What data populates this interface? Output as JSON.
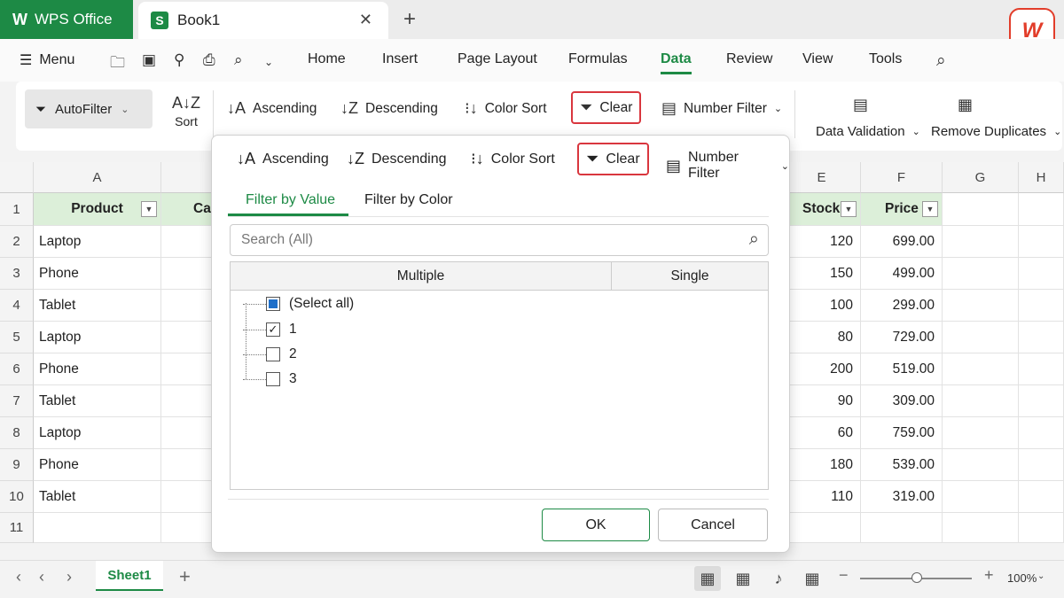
{
  "titlebar": {
    "app_tab": "WPS Office",
    "app_logo": "W",
    "doc_tab": "Book1",
    "doc_icon": "S",
    "brand_logo": "W"
  },
  "menubar": {
    "menu_label": "Menu",
    "tabs": [
      "Home",
      "Insert",
      "Page Layout",
      "Formulas",
      "Data",
      "Review",
      "View",
      "Tools"
    ],
    "active_tab": "Data"
  },
  "ribbon": {
    "autofilter": "AutoFilter",
    "sort": "Sort",
    "ascending": "Ascending",
    "descending": "Descending",
    "color_sort": "Color Sort",
    "clear": "Clear",
    "number_filter": "Number Filter",
    "data_validation": "Data Validation",
    "remove_duplicates": "Remove Duplicates"
  },
  "grid": {
    "columns": [
      "A",
      "E",
      "F",
      "G",
      "H"
    ],
    "header_row": {
      "product": "Product",
      "category_partial": "Ca",
      "stock": "Stock",
      "price": "Price"
    },
    "rows": [
      {
        "num": "1"
      },
      {
        "num": "2",
        "product": "Laptop",
        "stock": "120",
        "price": "699.00"
      },
      {
        "num": "3",
        "product": "Phone",
        "stock": "150",
        "price": "499.00"
      },
      {
        "num": "4",
        "product": "Tablet",
        "stock": "100",
        "price": "299.00"
      },
      {
        "num": "5",
        "product": "Laptop",
        "stock": "80",
        "price": "729.00"
      },
      {
        "num": "6",
        "product": "Phone",
        "stock": "200",
        "price": "519.00"
      },
      {
        "num": "7",
        "product": "Tablet",
        "stock": "90",
        "price": "309.00"
      },
      {
        "num": "8",
        "product": "Laptop",
        "stock": "60",
        "price": "759.00"
      },
      {
        "num": "9",
        "product": "Phone",
        "stock": "180",
        "price": "539.00"
      },
      {
        "num": "10",
        "product": "Tablet",
        "stock": "110",
        "price": "319.00"
      },
      {
        "num": "11"
      }
    ]
  },
  "popup": {
    "ascending": "Ascending",
    "descending": "Descending",
    "color_sort": "Color Sort",
    "clear": "Clear",
    "number_filter": "Number Filter",
    "tab_value": "Filter by Value",
    "tab_color": "Filter by Color",
    "search_placeholder": "Search (All)",
    "col_multiple": "Multiple",
    "col_single": "Single",
    "items": [
      {
        "label": "(Select all)",
        "state": "partial"
      },
      {
        "label": "1",
        "state": "checked"
      },
      {
        "label": "2",
        "state": "unchecked"
      },
      {
        "label": "3",
        "state": "unchecked"
      }
    ],
    "ok": "OK",
    "cancel": "Cancel"
  },
  "statusbar": {
    "sheet": "Sheet1",
    "zoom": "100%"
  },
  "colors": {
    "accent": "#1d8a45",
    "header_fill": "#dcefd9",
    "clear_outline": "#d9363e",
    "brand": "#e23d2a"
  }
}
